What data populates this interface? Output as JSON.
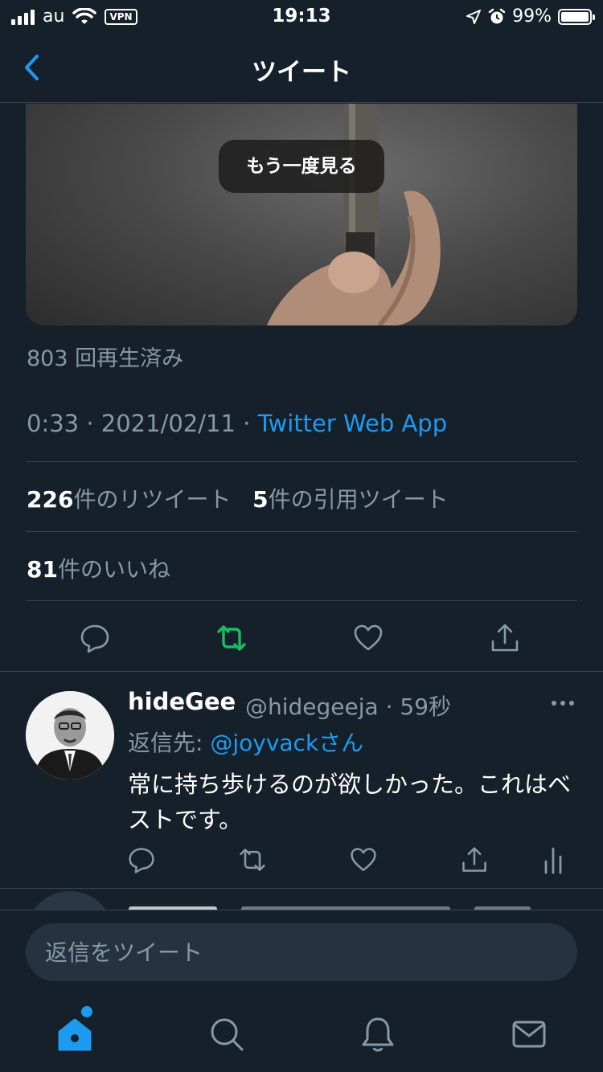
{
  "status_bar": {
    "carrier": "au",
    "vpn": "VPN",
    "time": "19:13",
    "battery": "99%"
  },
  "nav": {
    "title": "ツイート"
  },
  "video": {
    "rewatch_label": "もう一度見る"
  },
  "tweet": {
    "views": "803 回再生済み",
    "time": "0:33",
    "date": "2021/02/11",
    "sep": " · ",
    "source": "Twitter Web App",
    "retweets_count": "226",
    "retweets_label": "件のリツイート",
    "quotes_count": "5",
    "quotes_label": "件の引用ツイート",
    "likes_count": "81",
    "likes_label": "件のいいね"
  },
  "reply": {
    "name": "hideGee",
    "handle": "@hidegeeja · 59秒",
    "reply_to_label": "返信先: ",
    "reply_to_mention": "@joyvackさん",
    "body": "常に持ち歩けるのが欲しかった。これはベストです。"
  },
  "composer": {
    "placeholder": "返信をツイート"
  },
  "colors": {
    "background": "#15202b",
    "accent": "#1d9bf0",
    "retweet_active": "#17bf63",
    "secondary_text": "#8899a6",
    "divider": "#38444d"
  },
  "icons": {
    "back": "chevron-left-icon",
    "reply": "comment-icon",
    "retweet": "retweet-icon",
    "like": "heart-icon",
    "share": "share-icon",
    "analytics": "bar-chart-icon",
    "more": "more-horizontal-icon",
    "home": "home-icon",
    "search": "search-icon",
    "notifications": "bell-icon",
    "messages": "mail-icon"
  }
}
